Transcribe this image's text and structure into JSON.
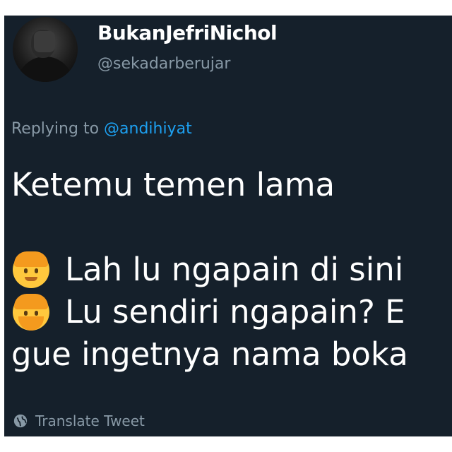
{
  "tweet": {
    "display_name": "BukanJefriNichol",
    "handle": "@sekadarberujar",
    "replying_prefix": "Replying to",
    "replying_to": "@andihiyat",
    "lines": [
      "Ketemu temen lama",
      "Lah lu ngapain di sini",
      "Lu sendiri ngapain? E",
      "gue ingetnya nama boka"
    ],
    "translate_label": "Translate Tweet"
  },
  "colors": {
    "background": "#15202b",
    "text": "#ffffff",
    "secondary": "#8899a6",
    "link": "#1da1f2"
  },
  "icons": {
    "avatar": "profile-avatar",
    "emoji_1": "man-emoji",
    "emoji_2": "bearded-man-emoji",
    "translate": "globe-icon"
  }
}
